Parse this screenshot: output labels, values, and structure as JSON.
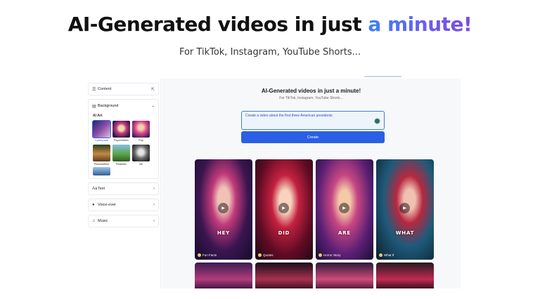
{
  "hero": {
    "title_main": "AI-Generated videos in just ",
    "title_accent": "a minute!",
    "subtitle": "For TikTok, Instagram, YouTube Shorts..."
  },
  "sidebar": {
    "content_label": "Content",
    "background_label": "Background",
    "ai_art_label": "AI Art",
    "styles": [
      {
        "label": "Cyberpunk",
        "selected": true
      },
      {
        "label": "Psychedelic",
        "selected": false
      },
      {
        "label": "Pop",
        "selected": false
      },
      {
        "label": "Pleasantism",
        "selected": false
      },
      {
        "label": "Realistic",
        "selected": false
      },
      {
        "label": "Ink",
        "selected": false
      }
    ],
    "text_label": "Text",
    "voiceover_label": "Voice-over",
    "music_label": "Music"
  },
  "main": {
    "title": "AI-Generated videos in just a minute!",
    "subtitle": "For TikTok, Instagram, YouTube Shorts...",
    "prompt_value": "Create a video about the first three American presidents",
    "create_label": "Create",
    "cards": [
      {
        "word": "HEY",
        "tag": "Fun Facts"
      },
      {
        "word": "DID",
        "tag": "Quotes"
      },
      {
        "word": "ARE",
        "tag": "Horror Story"
      },
      {
        "word": "WHAT",
        "tag": "What If"
      }
    ]
  },
  "colors": {
    "accent": "#2a5fe6",
    "accent_gradient_start": "#3b82f6",
    "accent_gradient_end": "#7c4ddb"
  }
}
